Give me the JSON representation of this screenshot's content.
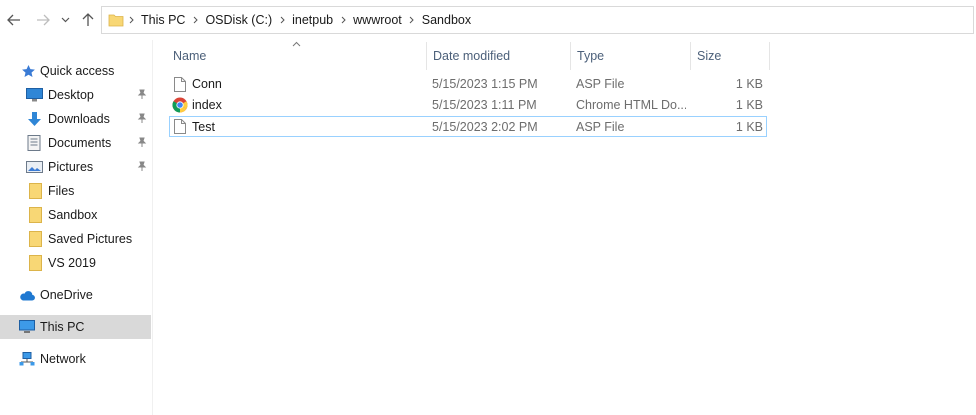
{
  "address_bar": {
    "breadcrumbs": [
      "This PC",
      "OSDisk (C:)",
      "inetpub",
      "wwwroot",
      "Sandbox"
    ]
  },
  "sidebar": {
    "quick_access": "Quick access",
    "items": [
      {
        "label": "Desktop",
        "icon": "desktop-icon",
        "pinned": true
      },
      {
        "label": "Downloads",
        "icon": "downloads-icon",
        "pinned": true
      },
      {
        "label": "Documents",
        "icon": "documents-icon",
        "pinned": true
      },
      {
        "label": "Pictures",
        "icon": "pictures-icon",
        "pinned": true
      },
      {
        "label": "Files",
        "icon": "folder-icon",
        "pinned": false
      },
      {
        "label": "Sandbox",
        "icon": "folder-icon",
        "pinned": false
      },
      {
        "label": "Saved Pictures",
        "icon": "folder-icon",
        "pinned": false
      },
      {
        "label": "VS 2019",
        "icon": "folder-icon",
        "pinned": false
      }
    ],
    "onedrive": "OneDrive",
    "this_pc": "This PC",
    "network": "Network"
  },
  "columns": {
    "name": "Name",
    "date_modified": "Date modified",
    "type": "Type",
    "size": "Size"
  },
  "files": [
    {
      "name": "Conn",
      "date": "5/15/2023 1:15 PM",
      "type": "ASP File",
      "size": "1 KB",
      "icon": "file-icon"
    },
    {
      "name": "index",
      "date": "5/15/2023 1:11 PM",
      "type": "Chrome HTML Do...",
      "size": "1 KB",
      "icon": "chrome-icon"
    },
    {
      "name": "Test",
      "date": "5/15/2023 2:02 PM",
      "type": "ASP File",
      "size": "1 KB",
      "icon": "file-icon"
    }
  ],
  "colors": {
    "selection_border": "#99d1ff",
    "selected_nav": "#d9d9d9",
    "header_text": "#4c607a",
    "folder_yellow": "#f8d775"
  }
}
